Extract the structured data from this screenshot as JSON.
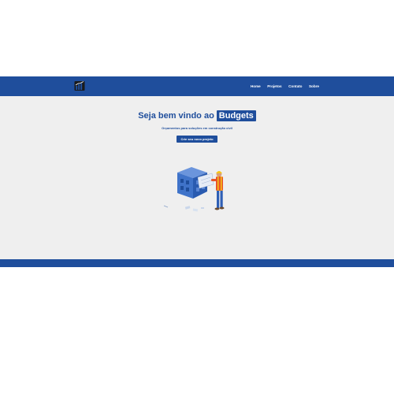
{
  "app": {
    "logo_icon": "building-chart-logo-icon"
  },
  "nav": {
    "items": [
      {
        "label": "Home"
      },
      {
        "label": "Projetos"
      },
      {
        "label": "Contato"
      },
      {
        "label": "Sobre"
      }
    ]
  },
  "hero": {
    "title_prefix": "Seja bem vindo ao",
    "title_brand": "Budgets",
    "subtitle": "Orçamentos para soluções em construção civil",
    "cta_label": "Crie seu novo projeto",
    "illustration": "construction-worker-with-blueprint-and-building-illustration"
  },
  "colors": {
    "primary": "#1f4e9c",
    "background": "#efefef",
    "accent_worker": "#e8542a",
    "helmet": "#f5c518"
  }
}
